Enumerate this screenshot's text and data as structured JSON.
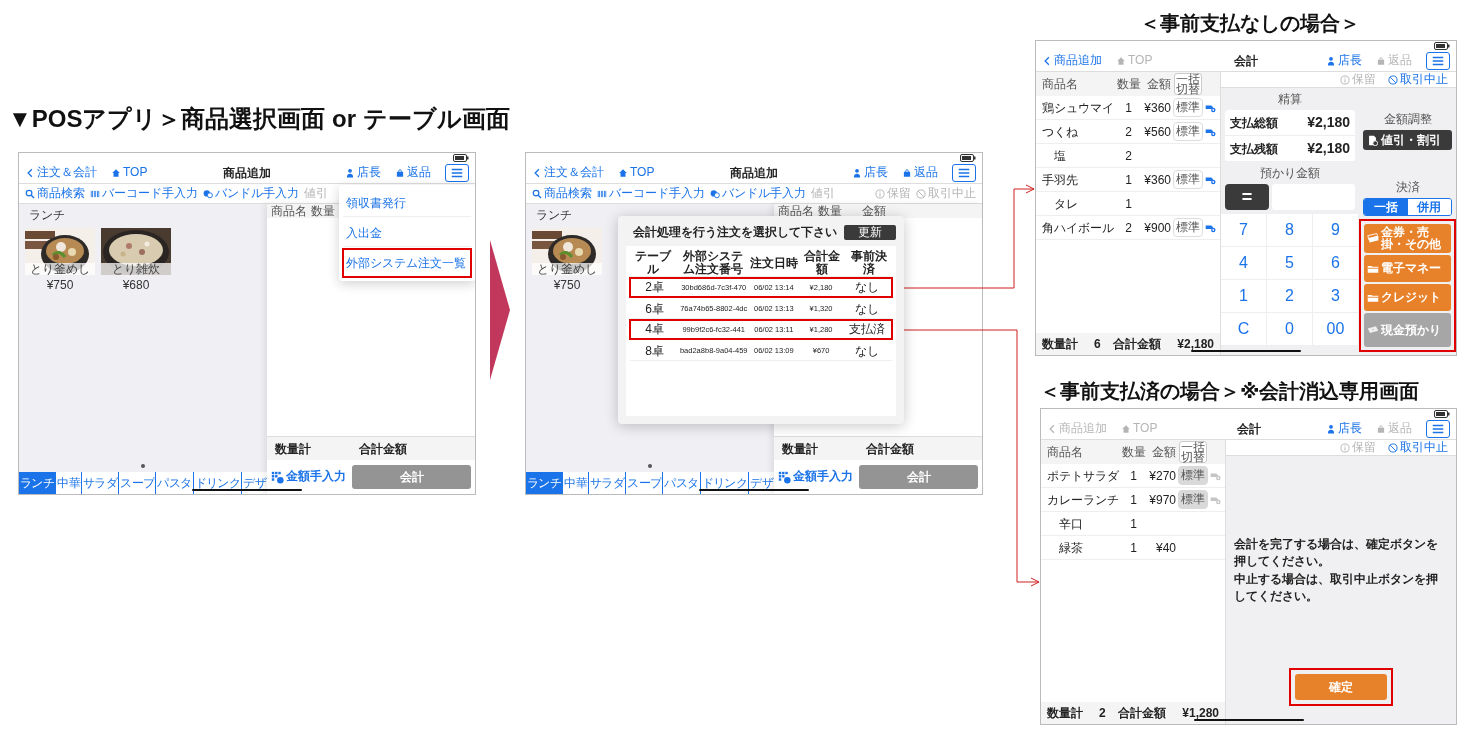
{
  "heading": "▼POSアプリ＞商品選択画面 or テーブル画面",
  "product_screens": [
    {
      "nav": {
        "back": {
          "label": "注文＆会計",
          "disabled": false
        },
        "home": {
          "label": "TOP",
          "disabled": false
        },
        "title": "商品追加",
        "staff": {
          "label": "店長",
          "disabled": false
        },
        "return": {
          "label": "返品",
          "disabled": false
        }
      },
      "toolbar": [
        {
          "label": "商品検索",
          "kind": "search",
          "disabled": false
        },
        {
          "label": "バーコード手入力",
          "kind": "barcode",
          "disabled": false
        },
        {
          "label": "バンドル手入力",
          "kind": "bundle",
          "disabled": false
        },
        {
          "label": "値引",
          "kind": "plain",
          "disabled": true
        }
      ],
      "category": "ランチ",
      "products": [
        {
          "name": "とり釜めし",
          "price": "¥750"
        },
        {
          "name": "とり雑炊",
          "price": "¥680"
        }
      ],
      "tabs": [
        {
          "label": "ランチ",
          "selected": true
        },
        {
          "label": "中華",
          "selected": false
        },
        {
          "label": "サラダ",
          "selected": false
        },
        {
          "label": "スープ",
          "selected": false
        },
        {
          "label": "パスタ",
          "selected": false
        },
        {
          "label": "ドリンク",
          "selected": false
        },
        {
          "label": "デザ",
          "selected": false
        }
      ],
      "order_columns": [
        "商品名",
        "数量"
      ],
      "summary": {
        "quantity_label": "数量計",
        "total_label": "合計金額"
      },
      "manual_button": "金額手入力",
      "checkout_button": {
        "label": "会計",
        "disabled": true
      },
      "menu": [
        {
          "label": "領収書発行",
          "highlighted": false
        },
        {
          "label": "入出金",
          "highlighted": false
        },
        {
          "label": "外部システム注文一覧",
          "highlighted": true
        }
      ]
    },
    {
      "nav": {
        "back": {
          "label": "注文＆会計",
          "disabled": false
        },
        "home": {
          "label": "TOP",
          "disabled": false
        },
        "title": "商品追加",
        "staff": {
          "label": "店長",
          "disabled": false
        },
        "return": {
          "label": "返品",
          "disabled": false
        }
      },
      "toolbar": [
        {
          "label": "商品検索",
          "kind": "search",
          "disabled": false
        },
        {
          "label": "バーコード手入力",
          "kind": "barcode",
          "disabled": false
        },
        {
          "label": "バンドル手入力",
          "kind": "bundle",
          "disabled": false
        },
        {
          "label": "値引",
          "kind": "plain",
          "disabled": true
        }
      ],
      "toolbar_right": [
        {
          "label": "保留",
          "kind": "hold",
          "disabled": true
        },
        {
          "label": "取引中止",
          "kind": "cancel",
          "disabled": true
        }
      ],
      "category": "ランチ",
      "products": [
        {
          "name": "とり釜めし",
          "price": "¥750"
        }
      ],
      "tabs": [
        {
          "label": "ランチ",
          "selected": true
        },
        {
          "label": "中華",
          "selected": false
        },
        {
          "label": "サラダ",
          "selected": false
        },
        {
          "label": "スープ",
          "selected": false
        },
        {
          "label": "パスタ",
          "selected": false
        },
        {
          "label": "ドリンク",
          "selected": false
        },
        {
          "label": "デザ",
          "selected": false
        }
      ],
      "order_columns": [
        "商品名",
        "数量",
        "金額"
      ],
      "summary": {
        "quantity_label": "数量計",
        "total_label": "合計金額"
      },
      "manual_button": "金額手入力",
      "checkout_button": {
        "label": "会計",
        "disabled": true
      },
      "modal": {
        "title": "会計処理を行う注文を選択して下さい",
        "refresh": "更新",
        "columns": [
          "テーブル",
          "外部システム注文番号",
          "注文日時",
          "合計金額",
          "事前決済"
        ],
        "rows": [
          {
            "cells": [
              "2卓",
              "30bd686d-7c3f-470",
              "06/02 13:14",
              "¥2,180",
              "なし"
            ],
            "highlighted": true
          },
          {
            "cells": [
              "6卓",
              "76a74b65-8802-4dc",
              "06/02 13:13",
              "¥1,320",
              "なし"
            ],
            "highlighted": false
          },
          {
            "cells": [
              "4卓",
              "99b9f2c6-fc32-441",
              "06/02 13:11",
              "¥1,280",
              "支払済"
            ],
            "highlighted": true
          },
          {
            "cells": [
              "8卓",
              "bad2a8b8-9a04-459",
              "06/02 13:09",
              "¥670",
              "なし"
            ],
            "highlighted": false
          }
        ]
      }
    }
  ],
  "checkout_screens": [
    {
      "heading": "＜事前支払なしの場合＞",
      "nav": {
        "back": {
          "label": "商品追加",
          "disabled": false
        },
        "home": {
          "label": "TOP",
          "disabled": true
        },
        "title": "会計",
        "staff": {
          "label": "店長",
          "disabled": false
        },
        "return": {
          "label": "返品",
          "disabled": true
        }
      },
      "order": {
        "columns": [
          "商品名",
          "数量",
          "金額"
        ],
        "toggle": [
          "一括",
          "切替"
        ],
        "items": [
          {
            "name": "鶏シュウマイ",
            "qty": "1",
            "amount": "¥360",
            "option": {
              "label": "標準",
              "disabled": false
            }
          },
          {
            "name": "つくね",
            "qty": "2",
            "amount": "¥560",
            "option": {
              "label": "標準",
              "disabled": false
            },
            "children": [
              {
                "name": "塩",
                "qty": "2"
              }
            ]
          },
          {
            "name": "手羽先",
            "qty": "1",
            "amount": "¥360",
            "option": {
              "label": "標準",
              "disabled": false
            },
            "children": [
              {
                "name": "タレ",
                "qty": "1"
              }
            ]
          },
          {
            "name": "角ハイボール",
            "qty": "2",
            "amount": "¥900",
            "option": {
              "label": "標準",
              "disabled": false
            }
          }
        ],
        "summary": {
          "quantity_label": "数量計",
          "quantity": "6",
          "total_label": "合計金額",
          "total": "¥2,180"
        }
      },
      "toolbar": [
        {
          "label": "保留",
          "kind": "hold",
          "disabled": true
        },
        {
          "label": "取引中止",
          "kind": "cancel",
          "disabled": false
        }
      ],
      "settlement": {
        "label": "精算",
        "rows": [
          {
            "label": "支払総額",
            "value": "¥2,180"
          },
          {
            "label": "支払残額",
            "value": "¥2,180"
          }
        ],
        "deposit_label": "預かり金額",
        "equals": "=",
        "keypad": [
          "7",
          "8",
          "9",
          "4",
          "5",
          "6",
          "1",
          "2",
          "3",
          "C",
          "0",
          "00"
        ]
      },
      "adjust": {
        "label": "金額調整",
        "button": "値引・割引"
      },
      "payment": {
        "label": "決済",
        "highlighted": true,
        "modes": [
          {
            "label": "一括",
            "selected": true
          },
          {
            "label": "併用",
            "selected": false
          }
        ],
        "buttons": [
          {
            "label": "金券・売掛・その他",
            "kind": "ticket",
            "disabled": false
          },
          {
            "label": "電子マネー",
            "kind": "card",
            "disabled": false
          },
          {
            "label": "クレジット",
            "kind": "card",
            "disabled": false
          },
          {
            "label": "現金預かり",
            "kind": "cash",
            "disabled": true
          }
        ]
      }
    },
    {
      "heading": "＜事前支払済の場合＞※会計消込専用画面",
      "nav": {
        "back": {
          "label": "商品追加",
          "disabled": true
        },
        "home": {
          "label": "TOP",
          "disabled": true
        },
        "title": "会計",
        "staff": {
          "label": "店長",
          "disabled": false
        },
        "return": {
          "label": "返品",
          "disabled": true
        }
      },
      "order": {
        "columns": [
          "商品名",
          "数量",
          "金額"
        ],
        "toggle": [
          "一括",
          "切替"
        ],
        "items": [
          {
            "name": "ポテトサラダ",
            "qty": "1",
            "amount": "¥270",
            "option": {
              "label": "標準",
              "disabled": true
            }
          },
          {
            "name": "カレーランチ",
            "qty": "1",
            "amount": "¥970",
            "option": {
              "label": "標準",
              "disabled": true
            },
            "children": [
              {
                "name": "辛口",
                "qty": "1"
              },
              {
                "name": "緑茶",
                "qty": "1",
                "amount": "¥40"
              }
            ]
          }
        ],
        "summary": {
          "quantity_label": "数量計",
          "quantity": "2",
          "total_label": "合計金額",
          "total": "¥1,280"
        }
      },
      "toolbar": [
        {
          "label": "保留",
          "kind": "hold",
          "disabled": true
        },
        {
          "label": "取引中止",
          "kind": "cancel",
          "disabled": false
        }
      ],
      "message": [
        "会計を完了する場合は、確定ボタンを押してください。",
        "中止する場合は、取引中止ボタンを押してください。"
      ],
      "confirm": {
        "label": "確定",
        "highlighted": true
      }
    }
  ]
}
